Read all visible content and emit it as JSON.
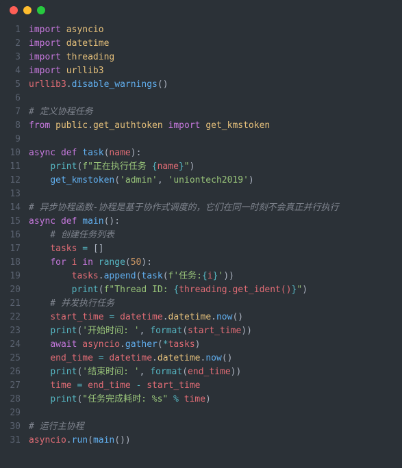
{
  "window": {
    "controls": [
      "close",
      "minimize",
      "zoom"
    ]
  },
  "gutter": {
    "start": 1,
    "end": 31
  },
  "code": {
    "lines": [
      {
        "tokens": [
          [
            "kw",
            "import"
          ],
          [
            "",
            ""
          ],
          [
            "",
            ""
          ],
          [
            "",
            ""
          ],
          [
            "",
            ""
          ],
          [
            "",
            ""
          ],
          [
            "",
            ""
          ]
        ],
        "raw": "import asyncio"
      },
      {
        "raw": "import datetime"
      },
      {
        "raw": "import threading"
      },
      {
        "raw": "import urllib3"
      },
      {
        "raw": "urllib3.disable_warnings()"
      },
      {
        "raw": ""
      },
      {
        "raw": "# 定义协程任务"
      },
      {
        "raw": "from public.get_authtoken import get_kmstoken"
      },
      {
        "raw": ""
      },
      {
        "raw": "async def task(name):"
      },
      {
        "raw": "    print(f\"正在执行任务 {name}\")"
      },
      {
        "raw": "    get_kmstoken('admin', 'uniontech2019')"
      },
      {
        "raw": ""
      },
      {
        "raw": "# 异步协程函数-协程是基于协作式调度的，它们在同一时刻不会真正并行执行"
      },
      {
        "raw": "async def main():"
      },
      {
        "raw": "    # 创建任务列表"
      },
      {
        "raw": "    tasks = []"
      },
      {
        "raw": "    for i in range(50):"
      },
      {
        "raw": "        tasks.append(task(f'任务:{i}'))"
      },
      {
        "raw": "        print(f\"Thread ID: {threading.get_ident()}\")"
      },
      {
        "raw": "    # 并发执行任务"
      },
      {
        "raw": "    start_time = datetime.datetime.now()"
      },
      {
        "raw": "    print('开始时间: ', format(start_time))"
      },
      {
        "raw": "    await asyncio.gather(*tasks)"
      },
      {
        "raw": "    end_time = datetime.datetime.now()"
      },
      {
        "raw": "    print('结束时间: ', format(end_time))"
      },
      {
        "raw": "    time = end_time - start_time"
      },
      {
        "raw": "    print(\"任务完成耗时: %s\" % time)"
      },
      {
        "raw": ""
      },
      {
        "raw": "# 运行主协程"
      },
      {
        "raw": "asyncio.run(main())"
      }
    ]
  }
}
